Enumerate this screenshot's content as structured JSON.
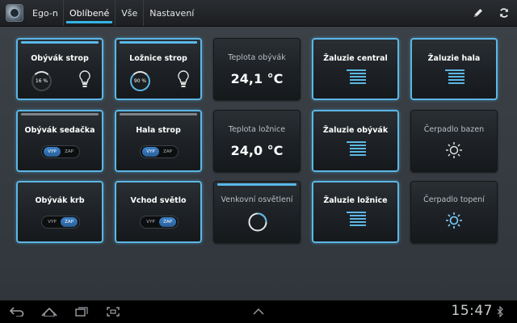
{
  "app": {
    "title": "Ego-n"
  },
  "tabs": [
    {
      "label": "Oblíbené",
      "active": true
    },
    {
      "label": "Vše",
      "active": false
    },
    {
      "label": "Nastavení",
      "active": false
    }
  ],
  "toolbar": {
    "edit_icon": "pencil-icon",
    "refresh_icon": "refresh-icon"
  },
  "colors": {
    "accent": "#33b5e5",
    "tile_border": "#5cb7e4"
  },
  "tiles": {
    "obyvak_strop": {
      "label": "Obývák strop",
      "level": "16 %",
      "level_value": 0.16
    },
    "loznice_strop": {
      "label": "Ložnice strop",
      "level": "90 %",
      "level_value": 0.9
    },
    "teplota_obyvak": {
      "label": "Teplota obývák",
      "value": "24,1 °C"
    },
    "zaluzie_central": {
      "label": "Žaluzie central"
    },
    "zaluzie_hala": {
      "label": "Žaluzie hala"
    },
    "obyvak_sedacka": {
      "label": "Obývák sedačka",
      "off": "VYP",
      "on": "ZAP",
      "state": "VYP"
    },
    "hala_strop": {
      "label": "Hala strop",
      "off": "VYP",
      "on": "ZAP",
      "state": "VYP"
    },
    "teplota_loznice": {
      "label": "Teplota ložnice",
      "value": "24,0 °C"
    },
    "zaluzie_obyvak": {
      "label": "Žaluzie obývák"
    },
    "cerpadlo_bazen": {
      "label": "Čerpadlo bazen"
    },
    "obyvak_krb": {
      "label": "Obývák krb",
      "off": "VYP",
      "on": "ZAP",
      "state": "ZAP"
    },
    "vchod_svetlo": {
      "label": "Vchod světlo",
      "off": "VYP",
      "on": "ZAP",
      "state": "ZAP"
    },
    "venkovni_osvetleni": {
      "label": "Venkovní osvětlení"
    },
    "zaluzie_loznice": {
      "label": "Žaluzie ložnice"
    },
    "cerpadlo_topeni": {
      "label": "Čerpadlo topení"
    }
  },
  "system_bar": {
    "time": "15:47"
  }
}
